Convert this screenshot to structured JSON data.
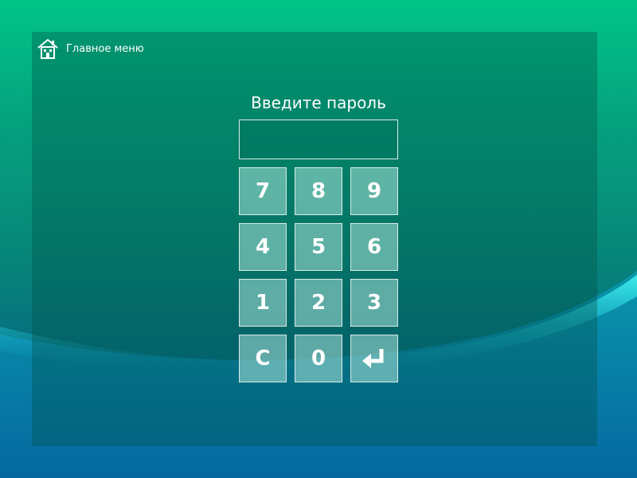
{
  "header": {
    "home_label": "Главное меню",
    "home_icon": "house-icon"
  },
  "login": {
    "prompt": "Введите пароль",
    "password_value": ""
  },
  "keypad": {
    "keys": [
      "7",
      "8",
      "9",
      "4",
      "5",
      "6",
      "1",
      "2",
      "3",
      "C",
      "0"
    ],
    "enter_icon": "enter-return-icon"
  },
  "colors": {
    "background_top": "#00c587",
    "background_bottom": "#0567a0",
    "key_fill": "#aae1d7",
    "text": "#ffffff"
  }
}
